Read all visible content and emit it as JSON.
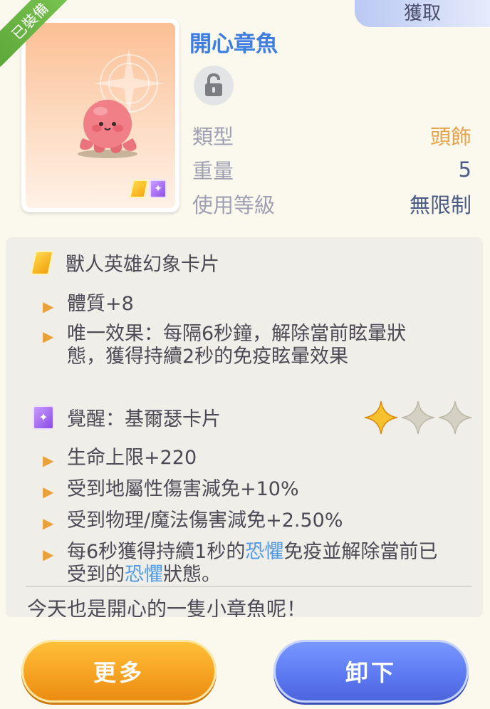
{
  "header": {
    "acquire_label": "獲取"
  },
  "item": {
    "equipped_label": "已裝備",
    "name": "開心章魚",
    "stats": [
      {
        "label": "類型",
        "value": "頭飾"
      },
      {
        "label": "重量",
        "value": "5"
      },
      {
        "label": "使用等級",
        "value": "無限制"
      }
    ]
  },
  "card1": {
    "title": "獸人英雄幻象卡片",
    "effects": [
      {
        "text": "體質+8"
      },
      {
        "text": "唯一效果：每隔6秒鐘，解除當前眩暈狀態，獲得持續2秒的免疫眩暈效果"
      }
    ]
  },
  "card2": {
    "title": "覺醒：基爾瑟卡片",
    "stars_filled": 1,
    "stars_total": 3,
    "effects": [
      {
        "text": "生命上限+220"
      },
      {
        "text": "受到地屬性傷害減免+10%"
      },
      {
        "text": "受到物理/魔法傷害減免+2.50%"
      }
    ],
    "effect4": {
      "part1": "每6秒獲得持續1秒的",
      "highlight1": "恐懼",
      "part2": "免疫並解除當前已受到的",
      "highlight2": "恐懼",
      "part3": "狀態。"
    }
  },
  "flavor_text": "今天也是開心的一隻小章魚呢！",
  "buttons": {
    "more": "更多",
    "unequip": "卸下"
  },
  "colors": {
    "name_blue": "#3f7ee0",
    "highlight_blue": "#4f9be6",
    "orange_btn": "#f5a020",
    "blue_btn": "#5b78f0"
  }
}
